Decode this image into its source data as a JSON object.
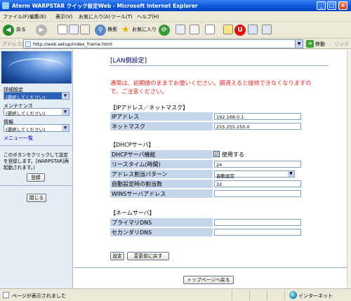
{
  "window": {
    "title": "Aterm WARPSTAR クイック設定Web - Microsoft Internet Explorer"
  },
  "menu": [
    "ファイル(F)",
    "編集(E)",
    "表示(V)",
    "お気に入り(A)",
    "ツール(T)",
    "ヘルプ(H)"
  ],
  "toolbar": {
    "back": "戻る",
    "search": "検索",
    "favorites": "お気に入り"
  },
  "addressbar": {
    "label": "アドレス(D)",
    "url": "http://web.setup/index_frame.html",
    "go": "移動",
    "links": "リンク"
  },
  "sidebar": {
    "advanced_label": "詳細設定",
    "advanced_value": "(選択してください)",
    "maintenance_label": "メンテナンス",
    "maintenance_value": "(選択してください)",
    "info_label": "情報",
    "info_value": "(選択してください)",
    "menu_list": "メニュー一覧",
    "note": "このボタンをクリックして設定を登録します。[WARPSTAR]再起動されます。)",
    "register_button": "登録",
    "close_button": "閉じる"
  },
  "main": {
    "title": "[LAN側設定]",
    "warning": "通常は、初期値のままでお使いください。間違えると接続できなくなりますので、ご注意ください。",
    "ip_section": "【IPアドレス／ネットマスク】",
    "ip_address_label": "IPアドレス",
    "ip_address_value": "192.168.0.1",
    "netmask_label": "ネットマスク",
    "netmask_value": "255.255.255.0",
    "dhcp_section": "【DHCPサーバ】",
    "dhcp_feature_label": "DHCPサーバ機能",
    "dhcp_feature_check": "☑",
    "dhcp_feature_text": "使用する",
    "lease_label": "リースタイム(時間)",
    "lease_value": "24",
    "pattern_label": "アドレス割当パターン",
    "pattern_value": "自動設定",
    "count_label": "自動設定時の割当数",
    "count_value": "32",
    "wins_label": "WINSサーバアドレス",
    "wins_value": "",
    "dns_section": "【ネームサーバ】",
    "primary_dns_label": "プライマリDNS",
    "primary_dns_value": "",
    "secondary_dns_label": "セカンダリDNS",
    "secondary_dns_value": "",
    "set_button": "設定",
    "reset_button": "変更前に戻す",
    "top_button": "トップページへ戻る"
  },
  "statusbar": {
    "text": "ページが表示されました",
    "zone": "インターネット"
  }
}
